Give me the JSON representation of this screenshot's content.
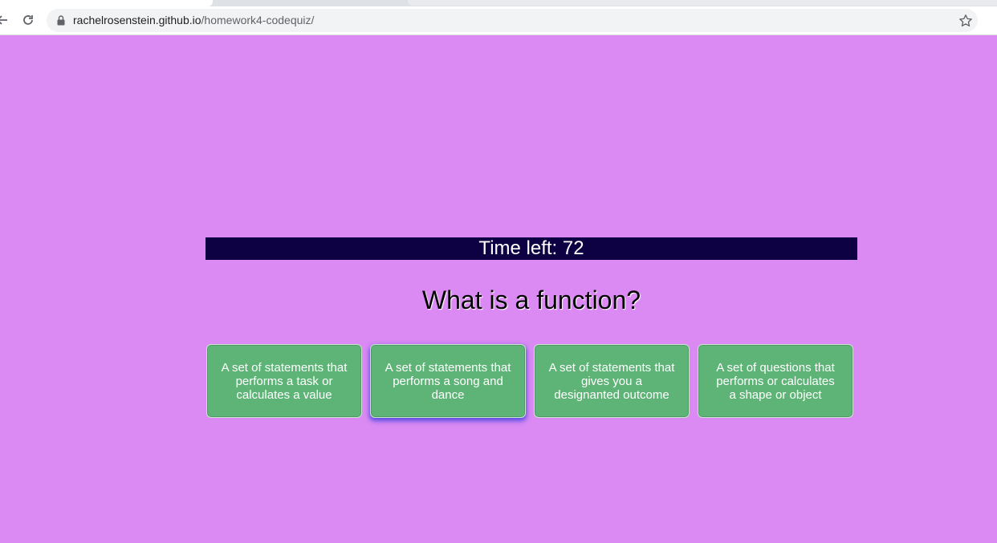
{
  "browser": {
    "url_host": "rachelrosenstein.github.io",
    "url_path": "/homework4-codequiz/",
    "back_icon": "arrow-left-icon",
    "reload_icon": "reload-icon",
    "lock_icon": "lock-icon",
    "bookmark_icon": "star-icon"
  },
  "quiz": {
    "timer_text": "Time left: 72",
    "question": "What is a function?",
    "answers": [
      "A set of statements that performs a task or calculates a value",
      "A set of statements that performs a song and dance",
      "A set of statements that gives you a designanted outcome",
      "A set of questions that performs or calculates a shape or object"
    ]
  },
  "colors": {
    "page_background": "#da8af2",
    "timer_background": "#0d0043",
    "answer_button": "#5db476",
    "focus_glow": "#5b4de6"
  }
}
